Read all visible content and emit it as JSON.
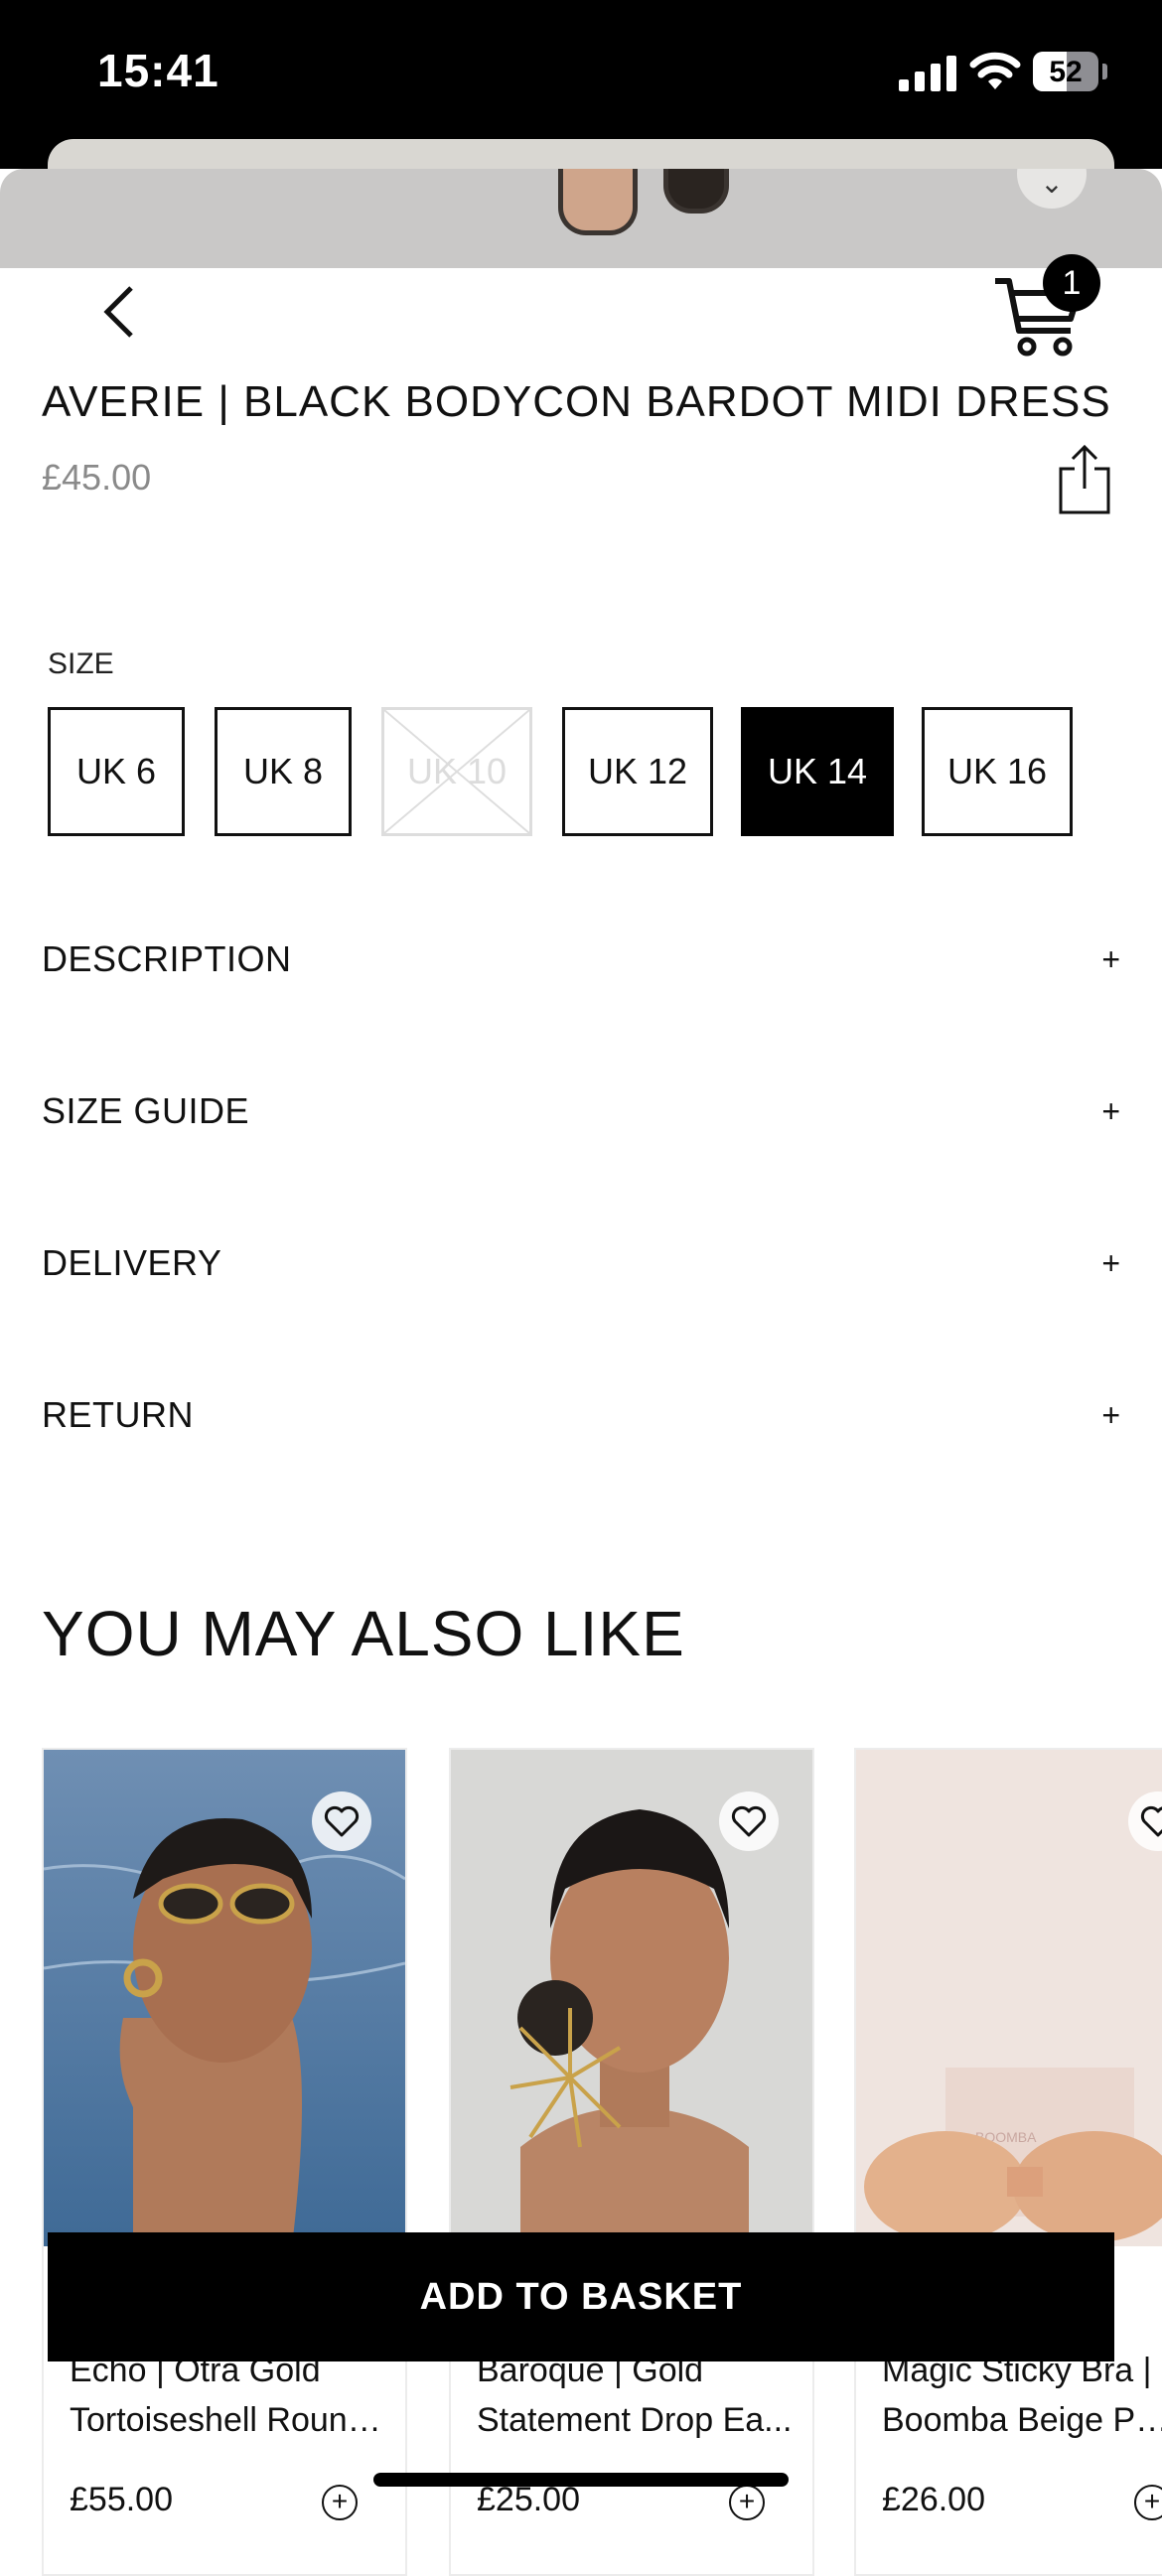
{
  "status_bar": {
    "time": "15:41",
    "battery": "52"
  },
  "header": {
    "cart_count": "1"
  },
  "product": {
    "title": "AVERIE | BLACK BODYCON BARDOT MIDI DRESS",
    "price": "£45.00"
  },
  "size": {
    "label": "SIZE",
    "options": [
      "UK 6",
      "UK 8",
      "UK 10",
      "UK 12",
      "UK 14",
      "UK 16"
    ],
    "selected": "UK 14",
    "unavailable": [
      "UK 10"
    ]
  },
  "accordion": [
    "DESCRIPTION",
    "SIZE GUIDE",
    "DELIVERY",
    "RETURN"
  ],
  "accordion_icon": "+",
  "recommendations": {
    "title": "YOU MAY ALSO LIKE",
    "items": [
      {
        "name_line1": "Echo | Otra Gold",
        "name_line2": "Tortoiseshell Round...",
        "price": "£55.00"
      },
      {
        "name_line1": "Baroque | Gold",
        "name_line2": "Statement Drop Ea...",
        "price": "£25.00"
      },
      {
        "name_line1": "Magic Sticky Bra |",
        "name_line2": "Boomba Beige Pad...",
        "price": "£26.00"
      }
    ],
    "product_badge": "BOOMBA"
  },
  "cta": {
    "add_to_basket": "ADD TO BASKET"
  },
  "icons": [
    "back-arrow-icon",
    "cart-icon",
    "share-icon",
    "heart-icon",
    "plus-circle-icon",
    "chevron-down-icon"
  ]
}
